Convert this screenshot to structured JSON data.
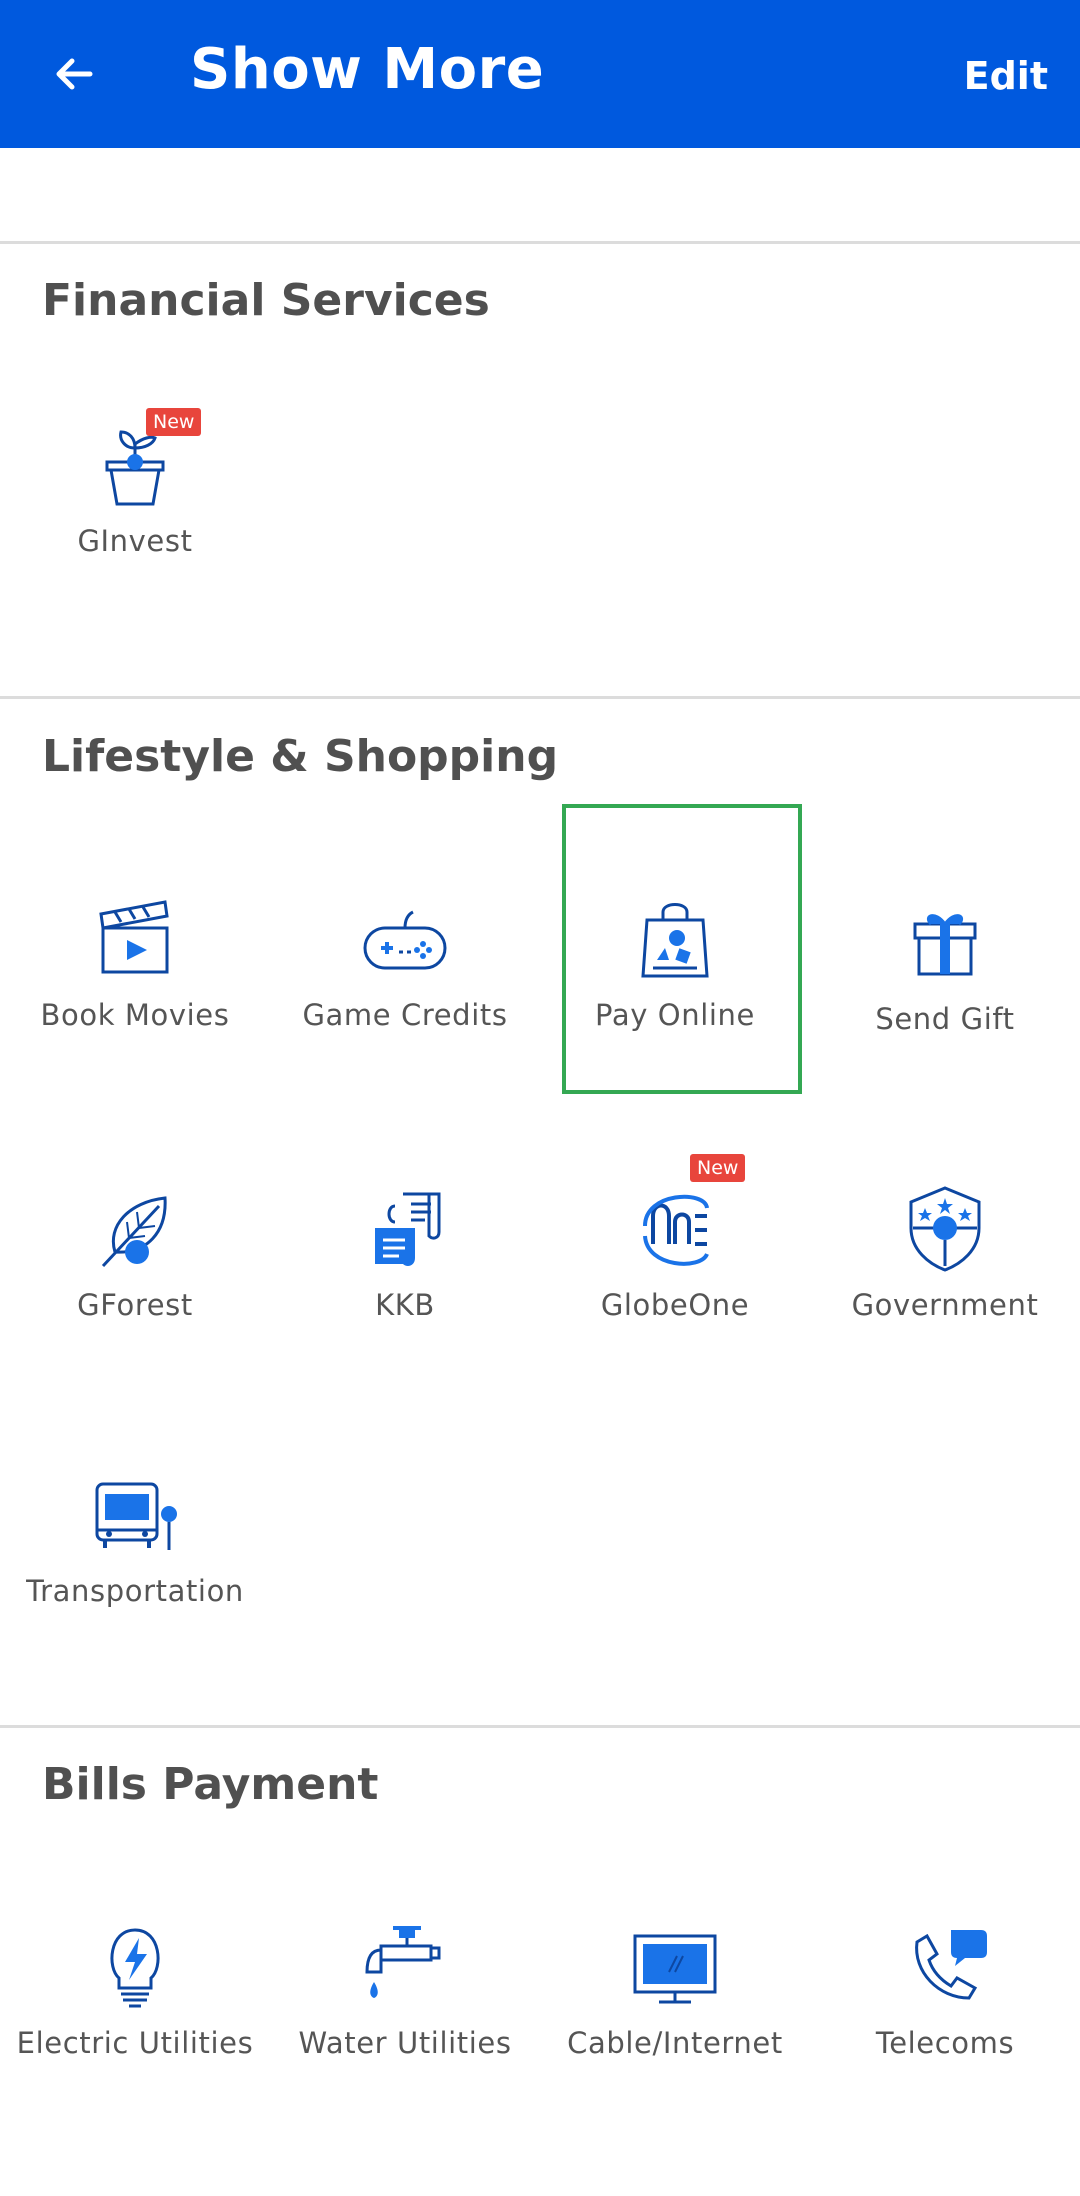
{
  "header": {
    "title": "Show More",
    "edit_label": "Edit",
    "back_icon": "arrow-left-icon"
  },
  "colors": {
    "header_bg": "#0059de",
    "icon_blue": "#1a73e8",
    "icon_dark": "#0d47a1",
    "badge_red": "#e8453c",
    "focus_green": "#34a853"
  },
  "sections": [
    {
      "title": "Financial Services",
      "items": [
        {
          "label": "GInvest",
          "icon": "plant-pot-icon",
          "badge": "New"
        }
      ]
    },
    {
      "title": "Lifestyle & Shopping",
      "items": [
        {
          "label": "Book Movies",
          "icon": "clapperboard-icon"
        },
        {
          "label": "Game Credits",
          "icon": "gamepad-icon"
        },
        {
          "label": "Pay Online",
          "icon": "shopping-bag-icon"
        },
        {
          "label": "Send Gift",
          "icon": "gift-icon"
        },
        {
          "label": "GForest",
          "icon": "leaf-icon"
        },
        {
          "label": "KKB",
          "icon": "receipt-icon"
        },
        {
          "label": "GlobeOne",
          "icon": "globeone-icon",
          "badge": "New"
        },
        {
          "label": "Government",
          "icon": "shield-stars-icon"
        },
        {
          "label": "Transportation",
          "icon": "bus-icon"
        }
      ]
    },
    {
      "title": "Bills Payment",
      "items": [
        {
          "label": "Electric Utilities",
          "icon": "lightbulb-icon"
        },
        {
          "label": "Water Utilities",
          "icon": "faucet-icon"
        },
        {
          "label": "Cable/Internet",
          "icon": "monitor-icon"
        },
        {
          "label": "Telecoms",
          "icon": "phone-chat-icon"
        }
      ]
    }
  ]
}
